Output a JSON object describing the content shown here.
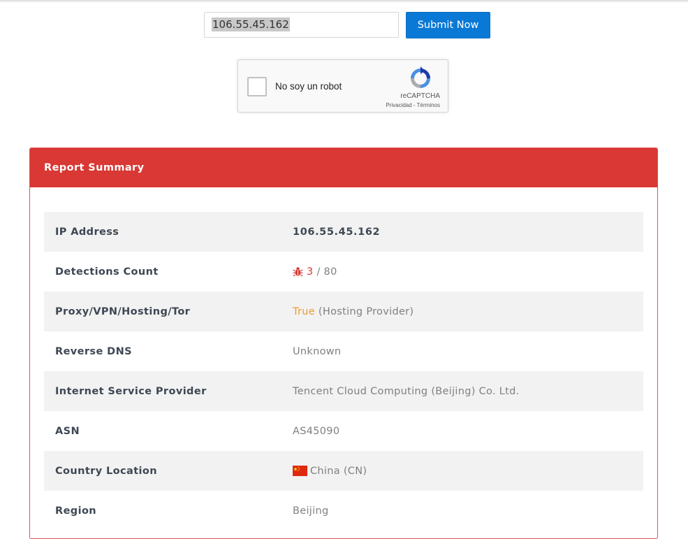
{
  "lookup": {
    "ip_value": "106.55.45.162",
    "submit_label": "Submit Now"
  },
  "captcha": {
    "label": "No soy un robot",
    "brand": "reCAPTCHA",
    "links": "Privacidad - Términos"
  },
  "report": {
    "title": "Report Summary",
    "rows": [
      {
        "label": "IP Address",
        "value": "106.55.45.162"
      },
      {
        "label": "Detections Count",
        "detections": "3",
        "total": "/ 80",
        "icon": "bug-icon"
      },
      {
        "label": "Proxy/VPN/Hosting/Tor",
        "status": "True",
        "detail": "(Hosting Provider)"
      },
      {
        "label": "Reverse DNS",
        "value": "Unknown"
      },
      {
        "label": "Internet Service Provider",
        "value": "Tencent Cloud Computing (Beijing) Co. Ltd."
      },
      {
        "label": "ASN",
        "value": "AS45090"
      },
      {
        "label": "Country Location",
        "value": "China (CN)",
        "icon": "china-flag-icon"
      },
      {
        "label": "Region",
        "value": "Beijing"
      }
    ]
  },
  "colors": {
    "primary_button": "#0a79d6",
    "panel_header": "#d93834",
    "status_true": "#ef9a2f",
    "detections": "#d93834"
  }
}
